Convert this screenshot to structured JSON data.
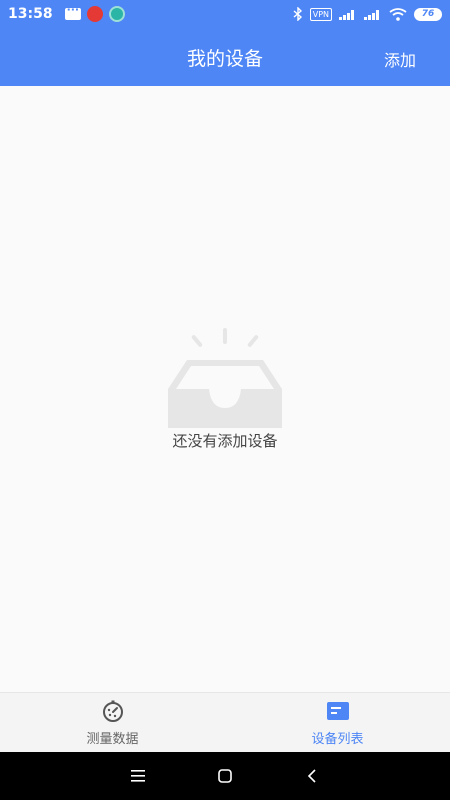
{
  "status_bar": {
    "time": "13:58",
    "vpn_label": "VPN",
    "battery": "76"
  },
  "header": {
    "title": "我的设备",
    "action_label": "添加"
  },
  "main": {
    "empty_message": "还没有添加设备"
  },
  "tabs": [
    {
      "label": "测量数据",
      "icon": "stopwatch-icon",
      "active": false
    },
    {
      "label": "设备列表",
      "icon": "device-list-icon",
      "active": true
    }
  ],
  "nav": {
    "menu": "menu-icon",
    "home": "home-icon",
    "back": "back-icon"
  },
  "colors": {
    "primary": "#4e86f5",
    "background": "#fafafa",
    "illustration": "#e6e6e6"
  }
}
